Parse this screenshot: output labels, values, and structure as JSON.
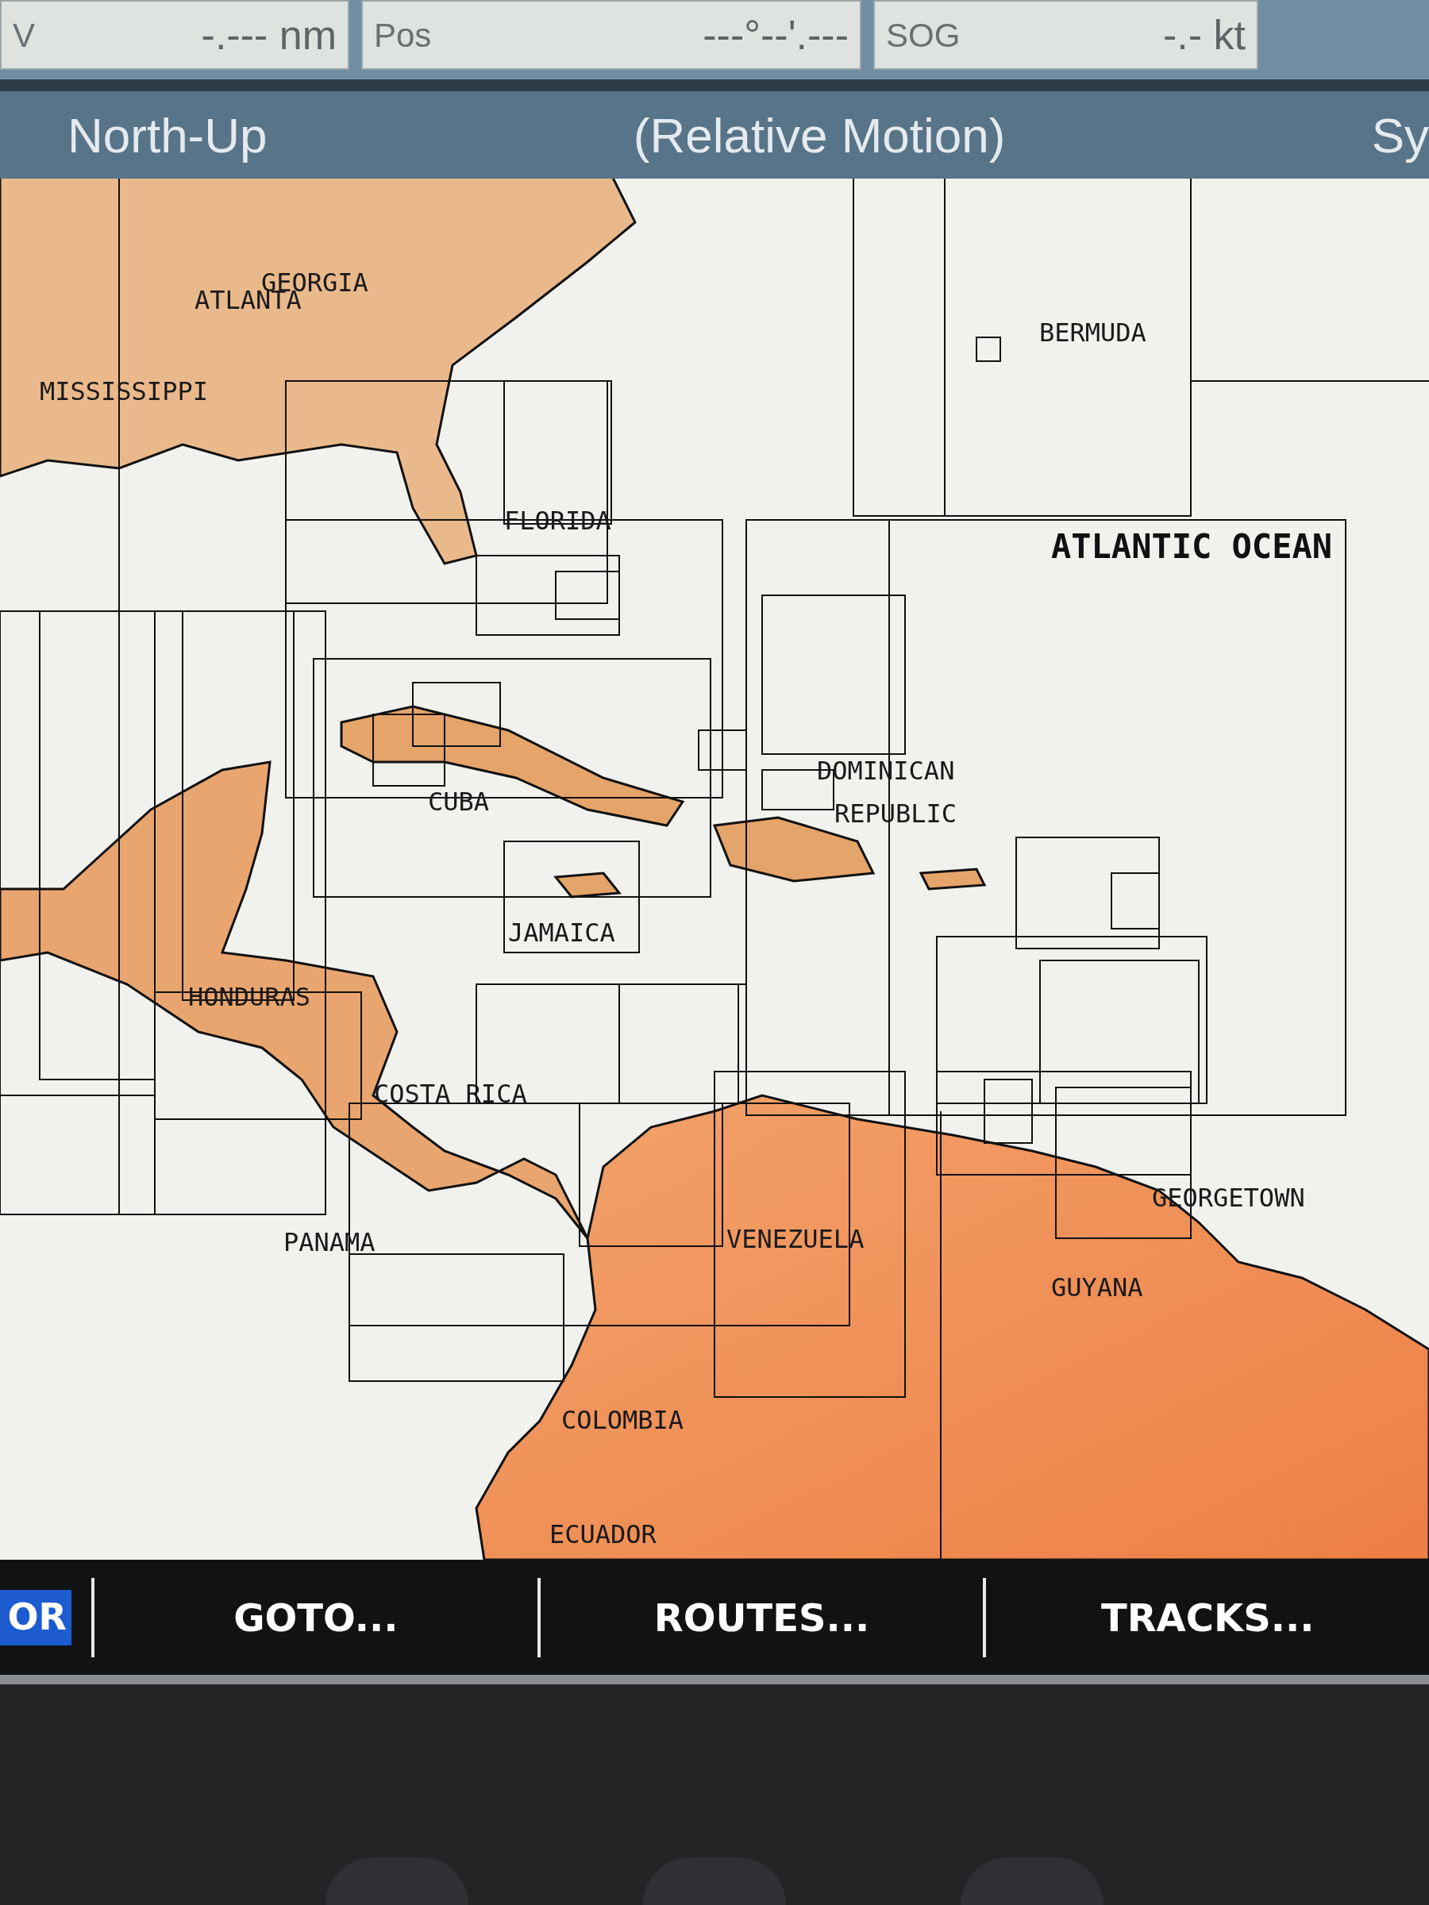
{
  "data_fields": [
    {
      "label": "V",
      "value": "-.--- nm"
    },
    {
      "label": "Pos",
      "value": "---°--'.---"
    },
    {
      "label": "SOG",
      "value": "-.- kt"
    }
  ],
  "header": {
    "orientation": "North-Up",
    "motion": "(Relative Motion)",
    "right_text": "Sy"
  },
  "map_labels": [
    {
      "text": "GEORGIA",
      "kind": "place"
    },
    {
      "text": "ATLANTA",
      "kind": "place"
    },
    {
      "text": "MISSISSIPPI",
      "kind": "place"
    },
    {
      "text": "BERMUDA",
      "kind": "place"
    },
    {
      "text": "FLORIDA",
      "kind": "place"
    },
    {
      "text": "ATLANTIC OCEAN",
      "kind": "sea"
    },
    {
      "text": "DOMINICAN",
      "kind": "place"
    },
    {
      "text": "REPUBLIC",
      "kind": "place"
    },
    {
      "text": "CUBA",
      "kind": "place"
    },
    {
      "text": "JAMAICA",
      "kind": "place"
    },
    {
      "text": "HONDURAS",
      "kind": "place"
    },
    {
      "text": "COSTA RICA",
      "kind": "place"
    },
    {
      "text": "PANAMA",
      "kind": "place"
    },
    {
      "text": "VENEZUELA",
      "kind": "place"
    },
    {
      "text": "GEORGETOWN",
      "kind": "place"
    },
    {
      "text": "GUYANA",
      "kind": "place"
    },
    {
      "text": "COLOMBIA",
      "kind": "place"
    },
    {
      "text": "ECUADOR",
      "kind": "place"
    }
  ],
  "softkeys": [
    {
      "label": "OR",
      "selected": true
    },
    {
      "label": "GOTO...",
      "selected": false
    },
    {
      "label": "ROUTES...",
      "selected": false
    },
    {
      "label": "TRACKS...",
      "selected": false
    }
  ]
}
